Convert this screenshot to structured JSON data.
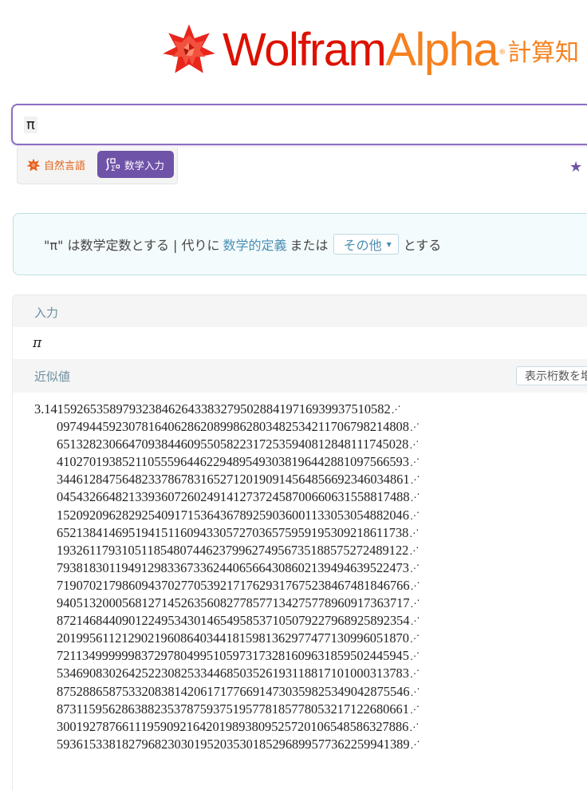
{
  "logo": {
    "part1": "Wolfram",
    "part2": "Alpha",
    "registered": "®",
    "jp": "計算知"
  },
  "search": {
    "query": "π"
  },
  "modes": {
    "natural_language": "自然言語",
    "math_input": "数学入力"
  },
  "assumption": {
    "prefix": "\"π\" は数学定数とする | 代りに",
    "link": "数学的定義",
    "middle": "または",
    "dropdown": "その他",
    "suffix": "とする"
  },
  "pods": {
    "input": {
      "title": "入力",
      "value": "π"
    },
    "approx": {
      "title": "近似値",
      "more_digits_button": "表示桁数を増やす",
      "continuation_mark": "⋰",
      "lines": [
        "3.14159265358979323846264338327950288419716939937510582",
        "097494459230781640628620899862803482534211706798214808",
        "651328230664709384460955058223172535940812848111745028",
        "410270193852110555964462294895493038196442881097566593",
        "344612847564823378678316527120190914564856692346034861",
        "045432664821339360726024914127372458700660631558817488",
        "152092096282925409171536436789259036001133053054882046",
        "652138414695194151160943305727036575959195309218611738",
        "193261179310511854807446237996274956735188575272489122",
        "793818301194912983367336244065664308602139494639522473",
        "719070217986094370277053921717629317675238467481846766",
        "940513200056812714526356082778577134275778960917363717",
        "872146844090122495343014654958537105079227968925892354",
        "201995611212902196086403441815981362977477130996051870",
        "721134999999837297804995105973173281609631859502445945",
        "534690830264252230825334468503526193118817101000313783",
        "875288658753320838142061717766914730359825349042875546",
        "873115956286388235378759375195778185778053217122680661",
        "300192787661119590921642019893809525720106548586327886",
        "593615338182796823030195203530185296899577362259941389"
      ]
    }
  },
  "colors": {
    "brand_red": "#dd1100",
    "brand_orange": "#f5811f",
    "accent_purple": "#6f53a8",
    "link_blue": "#4a8fb3"
  }
}
